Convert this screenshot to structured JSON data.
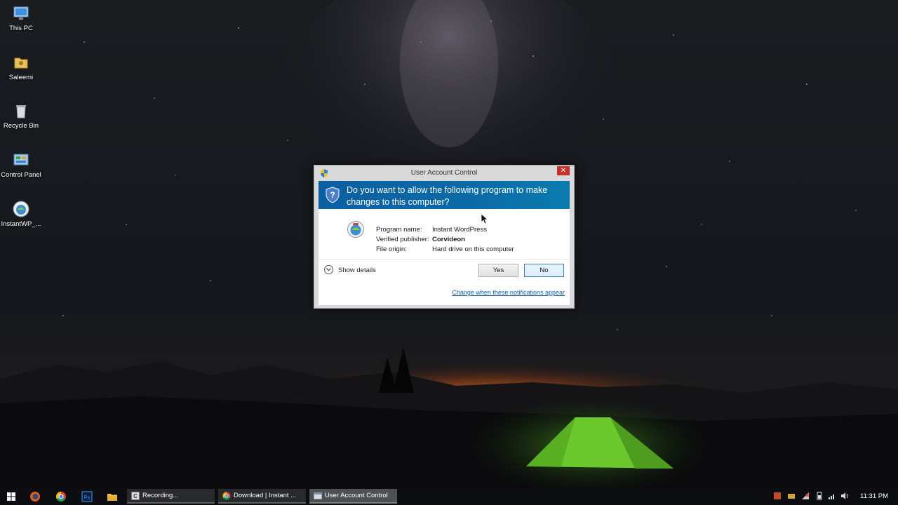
{
  "desktop": {
    "icons": [
      {
        "label": "This PC",
        "icon": "computer-icon"
      },
      {
        "label": "Saleemi",
        "icon": "user-folder-icon"
      },
      {
        "label": "Recycle Bin",
        "icon": "recycle-bin-icon"
      },
      {
        "label": "Control Panel",
        "icon": "control-panel-icon"
      },
      {
        "label": "InstantWP_...",
        "icon": "instantwp-icon"
      }
    ]
  },
  "uac": {
    "title": "User Account Control",
    "close_glyph": "✕",
    "question": "Do you want to allow the following program to make changes to this computer?",
    "program_name_label": "Program name:",
    "program_name": "Instant WordPress",
    "publisher_label": "Verified publisher:",
    "publisher": "Corvideon",
    "origin_label": "File origin:",
    "origin": "Hard drive on this computer",
    "show_details": "Show details",
    "yes": "Yes",
    "no": "No",
    "notifications_link": "Change when these notifications appear",
    "colors": {
      "banner": "#0b6aa7",
      "link": "#0f5fa8",
      "close": "#c7312b"
    }
  },
  "taskbar": {
    "pinned": [
      "start-icon",
      "firefox-icon",
      "chrome-icon",
      "photoshop-icon",
      "file-explorer-icon"
    ],
    "tasks": [
      {
        "label": "Recording...",
        "icon": "recorder-icon"
      },
      {
        "label": "Download | Instant ...",
        "icon": "chrome-icon"
      },
      {
        "label": "User Account Control",
        "icon": "uac-window-icon"
      }
    ],
    "clock": "11:31 PM"
  }
}
